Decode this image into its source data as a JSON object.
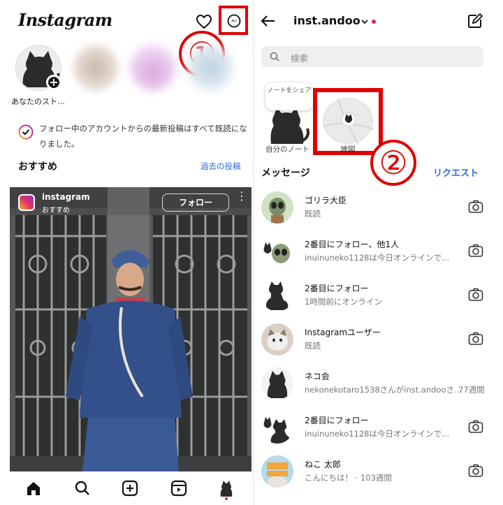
{
  "left": {
    "app_title": "Instagram",
    "annotation_1": "①",
    "story_self_label": "あなたのスト…",
    "story_add": "+",
    "notice": "フォロー中のアカウントからの最新投稿はすべて既読になりました。",
    "recommended_title": "おすすめ",
    "past_posts_link": "過去の投稿",
    "post": {
      "username": "instagram",
      "subtitle": "おすすめ",
      "follow": "フォロー",
      "more": "⋮"
    },
    "nav": [
      "home-icon",
      "search-icon",
      "create-icon",
      "reels-icon",
      "profile-icon"
    ]
  },
  "right": {
    "account": "inst.andoo",
    "search_placeholder": "検索",
    "note_bubble": "ノートをシェア",
    "note_label": "自分のノート",
    "map_label": "地図",
    "annotation_2": "②",
    "messages_title": "メッセージ",
    "requests": "リクエスト",
    "rows": [
      {
        "name": "ゴリラ大臣",
        "sub": "既読",
        "time": ""
      },
      {
        "name": "2番目にフォロー、他1人",
        "sub": "inuinuneko1128は今日オンラインで…",
        "time": ""
      },
      {
        "name": "2番目にフォロー",
        "sub": "1時間前にオンライン",
        "time": ""
      },
      {
        "name": "Instagramユーザー",
        "sub": "既読",
        "time": ""
      },
      {
        "name": "ネコ会",
        "sub": "nekonekotaro1538さんがinst.andooさ…",
        "time": "77週間"
      },
      {
        "name": "2番目にフォロー",
        "sub": "inuinuneko1128は今日オンラインで…",
        "time": ""
      },
      {
        "name": "ねこ 太郎",
        "sub": "こんにちは！ · 103週間",
        "time": ""
      }
    ]
  },
  "colors": {
    "accent_blue": "#2e6ad6",
    "annotation_red": "#e00000",
    "unread_dot": "#e0245e"
  }
}
